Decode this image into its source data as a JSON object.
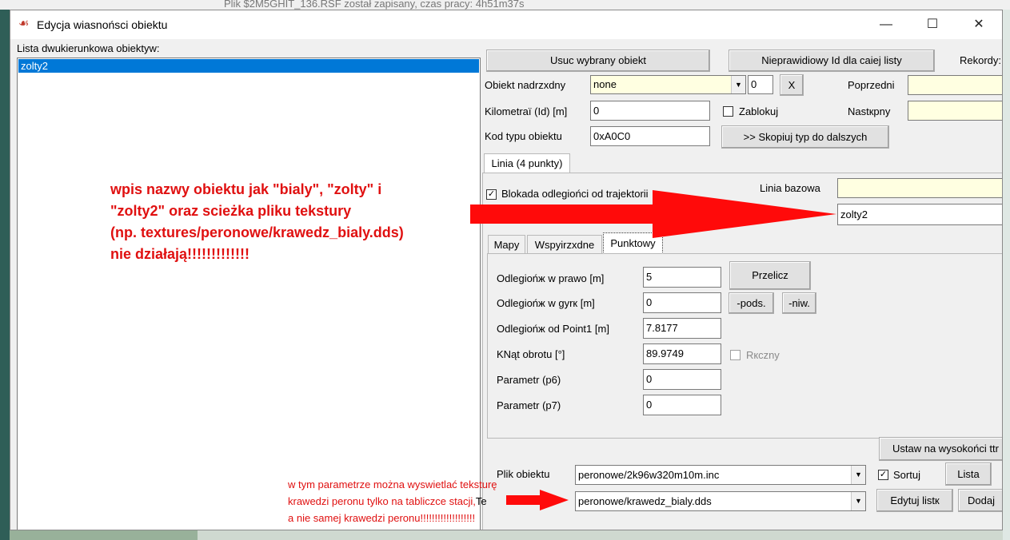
{
  "background_window": {
    "title": "Plik $2M5GHIT_136.RSF został zapisany, czas pracy: 4h51m37s"
  },
  "dialog": {
    "title": "Edycja wiasnońsci obiektu",
    "controls": {
      "minimize": "—",
      "maximize": "☐",
      "close": "✕"
    }
  },
  "left": {
    "list_label": "Lista dwukierunkowa obiektyw:",
    "items": [
      "zolty2"
    ]
  },
  "top": {
    "delete_button": "Usuc wybrany obiekt",
    "invalid_id_button": "Nieprawidiowy Id dla caiej listy",
    "records_label": "Rekordy:"
  },
  "fields": {
    "parent_label": "Obiekt nadrzxdny",
    "parent_value": "none",
    "parent_num": "0",
    "x_button": "X",
    "prev_label": "Poprzedni",
    "km_label": "Kilometraï (Id) [m]",
    "km_value": "0",
    "lock_label": "Zablokuj",
    "next_label": "Nastкpny",
    "type_label": "Kod typu obiektu",
    "type_value": "0xA0C0",
    "copy_type_button": ">> Skopiuj typ do dalszych"
  },
  "line_tab": {
    "tab_label": "Linia (4 punkty)",
    "block_label": "Blokada odlegiońci od trajektorii",
    "base_line_label": "Linia bazowa",
    "base_line_value": "",
    "name_value": "zolty2"
  },
  "subtabs": [
    "Mapy",
    "Wspyirzxdne",
    "Punktowy"
  ],
  "punktowy": {
    "right_label": "Odlegiońж w prawo [m]",
    "right_value": "5",
    "recalc_button": "Przelicz",
    "up_label": "Odlegiońж w gyrк [m]",
    "up_value": "0",
    "pods_button": "-pods.",
    "niw_button": "-niw.",
    "point1_label": "Odlegiońж od Point1 [m]",
    "point1_value": "7.8177",
    "angle_label": "KNąt obrotu [°]",
    "angle_value": "89.9749",
    "manual_label": "Rкczny",
    "p6_label": "Parametr (p6)",
    "p6_value": "0",
    "p7_label": "Parametr (p7)",
    "p7_value": "0"
  },
  "bottom": {
    "set_height_button": "Ustaw na wysokońci ttr",
    "file_label": "Plik obiektu",
    "file_value": "peronowe/2k96w320m10m.inc",
    "sort_label": "Sortuj",
    "list_button": "Lista",
    "texture_value": "peronowe/krawedz_bialy.dds",
    "edit_list_button": "Edytuj listк",
    "add_button": "Dodaj",
    "te_fragment": "Te"
  },
  "annotations": {
    "main": [
      "wpis nazwy obiektu jak \"bialy\", \"zolty\" i",
      "\"zolty2\" oraz scieżka pliku tekstury",
      "(np. textures/peronowe/krawedz_bialy.dds)",
      "nie działają!!!!!!!!!!!!!"
    ],
    "texture_note": [
      "w tym parametrze można wyswietlać teksturę",
      "krawedzi peronu tylko na tabliczce stacji,",
      "a nie samej krawedzi peronu!!!!!!!!!!!!!!!!!!!"
    ],
    "color": "#e01010"
  }
}
